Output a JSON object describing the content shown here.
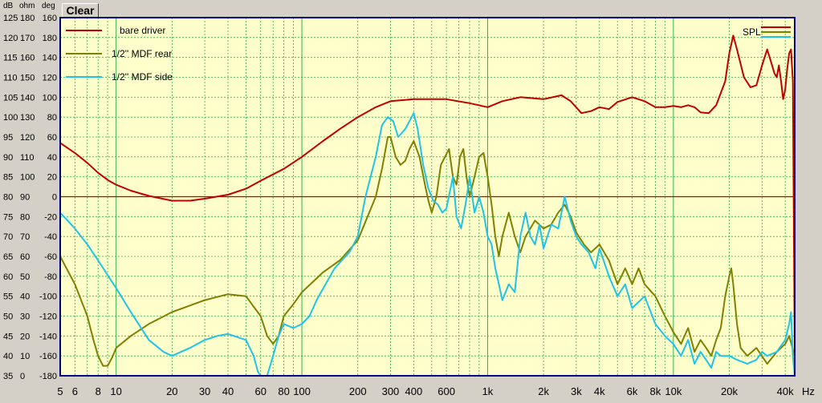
{
  "header": {
    "db_label": "dB",
    "ohm_label": "ohm",
    "deg_label": "deg",
    "clear_button": "Clear"
  },
  "colors": {
    "bare": "#c00000",
    "rear": "#808000",
    "side": "#1fc3e8",
    "grid": "#2db24a",
    "background": "#ffffcc",
    "frame": "#000080"
  },
  "chart_data": {
    "type": "line",
    "x_scale": "log",
    "xlim": [
      5,
      45000
    ],
    "x_ticks": [
      {
        "v": 5,
        "label": "5"
      },
      {
        "v": 6,
        "label": "6"
      },
      {
        "v": 8,
        "label": "8"
      },
      {
        "v": 10,
        "label": "10"
      },
      {
        "v": 20,
        "label": "20"
      },
      {
        "v": 30,
        "label": "30"
      },
      {
        "v": 40,
        "label": "40"
      },
      {
        "v": 60,
        "label": "60"
      },
      {
        "v": 80,
        "label": "80"
      },
      {
        "v": 100,
        "label": "100"
      },
      {
        "v": 200,
        "label": "200"
      },
      {
        "v": 300,
        "label": "300"
      },
      {
        "v": 400,
        "label": "400"
      },
      {
        "v": 600,
        "label": "600"
      },
      {
        "v": 1000,
        "label": "1k"
      },
      {
        "v": 2000,
        "label": "2k"
      },
      {
        "v": 3000,
        "label": "3k"
      },
      {
        "v": 4000,
        "label": "4k"
      },
      {
        "v": 6000,
        "label": "6k"
      },
      {
        "v": 8000,
        "label": "8k"
      },
      {
        "v": 10000,
        "label": "10k"
      },
      {
        "v": 20000,
        "label": "20k"
      },
      {
        "v": 40000,
        "label": "40k"
      }
    ],
    "x_unit": "Hz",
    "ylim": [
      35,
      125
    ],
    "y_ticks": [
      {
        "db": "125",
        "ohm": "180",
        "deg": "160"
      },
      {
        "db": "120",
        "ohm": "170",
        "deg": "180"
      },
      {
        "db": "115",
        "ohm": "160",
        "deg": "140"
      },
      {
        "db": "110",
        "ohm": "150",
        "deg": "120"
      },
      {
        "db": "105",
        "ohm": "140",
        "deg": "100"
      },
      {
        "db": "100",
        "ohm": "130",
        "deg": "80"
      },
      {
        "db": "95",
        "ohm": "120",
        "deg": "60"
      },
      {
        "db": "90",
        "ohm": "110",
        "deg": "40"
      },
      {
        "db": "85",
        "ohm": "100",
        "deg": "20"
      },
      {
        "db": "80",
        "ohm": "90",
        "deg": "0"
      },
      {
        "db": "75",
        "ohm": "80",
        "deg": "-20"
      },
      {
        "db": "70",
        "ohm": "70",
        "deg": "-40"
      },
      {
        "db": "65",
        "ohm": "60",
        "deg": "-60"
      },
      {
        "db": "60",
        "ohm": "50",
        "deg": "-80"
      },
      {
        "db": "55",
        "ohm": "40",
        "deg": "-100"
      },
      {
        "db": "50",
        "ohm": "30",
        "deg": "-120"
      },
      {
        "db": "45",
        "ohm": "20",
        "deg": "-140"
      },
      {
        "db": "40",
        "ohm": "10",
        "deg": "-160"
      },
      {
        "db": "35",
        "ohm": "0",
        "deg": "-180"
      }
    ],
    "reference_line_db": 80,
    "legend_right": "SPL",
    "series": [
      {
        "name": "bare driver",
        "color": "#c00000",
        "points": [
          [
            5,
            93.5
          ],
          [
            6,
            91
          ],
          [
            7,
            88.5
          ],
          [
            8,
            86
          ],
          [
            9,
            84.2
          ],
          [
            10,
            83
          ],
          [
            12,
            81.5
          ],
          [
            15,
            80.2
          ],
          [
            20,
            79
          ],
          [
            25,
            79
          ],
          [
            30,
            79.5
          ],
          [
            40,
            80.5
          ],
          [
            50,
            82
          ],
          [
            60,
            84
          ],
          [
            80,
            87
          ],
          [
            100,
            90
          ],
          [
            130,
            94
          ],
          [
            160,
            97
          ],
          [
            200,
            100
          ],
          [
            250,
            102.5
          ],
          [
            300,
            104
          ],
          [
            400,
            104.5
          ],
          [
            600,
            104.5
          ],
          [
            800,
            103.5
          ],
          [
            1000,
            102.5
          ],
          [
            1200,
            104
          ],
          [
            1500,
            105
          ],
          [
            2000,
            104.5
          ],
          [
            2500,
            105.5
          ],
          [
            2800,
            104
          ],
          [
            3200,
            101
          ],
          [
            3600,
            101.5
          ],
          [
            4000,
            102.5
          ],
          [
            4500,
            102
          ],
          [
            5000,
            103.8
          ],
          [
            6000,
            105
          ],
          [
            7000,
            104
          ],
          [
            8000,
            102.5
          ],
          [
            9000,
            102.5
          ],
          [
            10000,
            102.8
          ],
          [
            11000,
            102.5
          ],
          [
            12000,
            103
          ],
          [
            13000,
            102.5
          ],
          [
            14000,
            101.2
          ],
          [
            15500,
            101
          ],
          [
            17000,
            103
          ],
          [
            19000,
            109
          ],
          [
            20000,
            116
          ],
          [
            21000,
            120.5
          ],
          [
            22000,
            117
          ],
          [
            24000,
            110
          ],
          [
            26000,
            107.5
          ],
          [
            28000,
            108
          ],
          [
            30000,
            113
          ],
          [
            32000,
            117
          ],
          [
            33000,
            115
          ],
          [
            34000,
            113
          ],
          [
            35000,
            111
          ],
          [
            36000,
            110
          ],
          [
            37000,
            113
          ],
          [
            38000,
            109
          ],
          [
            39000,
            104.5
          ],
          [
            40000,
            107
          ],
          [
            41000,
            112
          ],
          [
            42000,
            116
          ],
          [
            43000,
            117
          ],
          [
            44000,
            109
          ],
          [
            45000,
            40
          ]
        ]
      },
      {
        "name": "1/2'' MDF rear",
        "color": "#808000",
        "points": [
          [
            5,
            65
          ],
          [
            6,
            58
          ],
          [
            7,
            50
          ],
          [
            7.5,
            44.5
          ],
          [
            8,
            40
          ],
          [
            8.5,
            37.5
          ],
          [
            9,
            37.5
          ],
          [
            9.5,
            39.5
          ],
          [
            10,
            42
          ],
          [
            12,
            45
          ],
          [
            15,
            48
          ],
          [
            20,
            51
          ],
          [
            30,
            54
          ],
          [
            40,
            55.5
          ],
          [
            50,
            55
          ],
          [
            60,
            50
          ],
          [
            65,
            45
          ],
          [
            70,
            43
          ],
          [
            75,
            45
          ],
          [
            80,
            50
          ],
          [
            90,
            53
          ],
          [
            100,
            56
          ],
          [
            130,
            61
          ],
          [
            160,
            64
          ],
          [
            200,
            69
          ],
          [
            250,
            80
          ],
          [
            270,
            87
          ],
          [
            290,
            95
          ],
          [
            300,
            95
          ],
          [
            320,
            90
          ],
          [
            340,
            88
          ],
          [
            360,
            89
          ],
          [
            380,
            92
          ],
          [
            400,
            94
          ],
          [
            430,
            90
          ],
          [
            460,
            83
          ],
          [
            480,
            79
          ],
          [
            500,
            76
          ],
          [
            530,
            80
          ],
          [
            560,
            88
          ],
          [
            590,
            90
          ],
          [
            620,
            92
          ],
          [
            650,
            85
          ],
          [
            680,
            83
          ],
          [
            710,
            90
          ],
          [
            740,
            92
          ],
          [
            770,
            85
          ],
          [
            800,
            80
          ],
          [
            850,
            85
          ],
          [
            900,
            90
          ],
          [
            950,
            91
          ],
          [
            1000,
            85
          ],
          [
            1050,
            78
          ],
          [
            1100,
            70
          ],
          [
            1150,
            65
          ],
          [
            1200,
            70
          ],
          [
            1300,
            76
          ],
          [
            1400,
            70
          ],
          [
            1500,
            66
          ],
          [
            1600,
            70
          ],
          [
            1800,
            74
          ],
          [
            2000,
            72
          ],
          [
            2200,
            73
          ],
          [
            2400,
            76
          ],
          [
            2600,
            78
          ],
          [
            2800,
            75
          ],
          [
            3000,
            71
          ],
          [
            3300,
            68
          ],
          [
            3600,
            66
          ],
          [
            4000,
            68
          ],
          [
            4500,
            64
          ],
          [
            5000,
            58
          ],
          [
            5500,
            62
          ],
          [
            6000,
            58
          ],
          [
            6500,
            62
          ],
          [
            7000,
            58
          ],
          [
            8000,
            55
          ],
          [
            9000,
            50
          ],
          [
            10000,
            46
          ],
          [
            11000,
            43
          ],
          [
            12000,
            47
          ],
          [
            13000,
            41
          ],
          [
            14000,
            44
          ],
          [
            15000,
            42
          ],
          [
            16000,
            40
          ],
          [
            17000,
            44
          ],
          [
            18000,
            47
          ],
          [
            19000,
            55
          ],
          [
            20000,
            60
          ],
          [
            20500,
            62
          ],
          [
            21000,
            58
          ],
          [
            22000,
            48
          ],
          [
            23000,
            42
          ],
          [
            25000,
            40
          ],
          [
            28000,
            42
          ],
          [
            32000,
            38
          ],
          [
            36000,
            41
          ],
          [
            40000,
            43
          ],
          [
            42000,
            45
          ],
          [
            45000,
            40
          ]
        ]
      },
      {
        "name": "1/2'' MDF side",
        "color": "#1fc3e8",
        "points": [
          [
            5,
            76
          ],
          [
            6,
            72
          ],
          [
            7,
            68
          ],
          [
            8,
            64
          ],
          [
            10,
            57
          ],
          [
            12,
            51
          ],
          [
            15,
            44
          ],
          [
            18,
            41
          ],
          [
            20,
            40
          ],
          [
            25,
            42
          ],
          [
            30,
            44
          ],
          [
            35,
            45
          ],
          [
            40,
            45.5
          ],
          [
            50,
            44
          ],
          [
            55,
            40
          ],
          [
            58,
            36
          ],
          [
            60,
            34
          ],
          [
            65,
            35
          ],
          [
            70,
            40
          ],
          [
            75,
            45
          ],
          [
            80,
            48
          ],
          [
            90,
            47
          ],
          [
            100,
            48
          ],
          [
            110,
            50
          ],
          [
            120,
            54
          ],
          [
            150,
            62
          ],
          [
            180,
            66
          ],
          [
            200,
            70
          ],
          [
            220,
            80
          ],
          [
            250,
            90
          ],
          [
            270,
            98
          ],
          [
            290,
            100
          ],
          [
            310,
            99
          ],
          [
            330,
            95
          ],
          [
            360,
            97
          ],
          [
            380,
            99
          ],
          [
            400,
            101
          ],
          [
            420,
            97
          ],
          [
            450,
            88
          ],
          [
            480,
            82
          ],
          [
            510,
            79
          ],
          [
            540,
            78
          ],
          [
            570,
            76
          ],
          [
            600,
            77
          ],
          [
            650,
            85
          ],
          [
            680,
            75
          ],
          [
            720,
            72
          ],
          [
            760,
            78
          ],
          [
            800,
            85
          ],
          [
            850,
            76
          ],
          [
            900,
            80
          ],
          [
            950,
            76
          ],
          [
            1000,
            70
          ],
          [
            1050,
            68
          ],
          [
            1100,
            62
          ],
          [
            1150,
            58
          ],
          [
            1200,
            54
          ],
          [
            1300,
            58
          ],
          [
            1400,
            56
          ],
          [
            1500,
            70
          ],
          [
            1600,
            76
          ],
          [
            1700,
            70
          ],
          [
            1800,
            68
          ],
          [
            1900,
            73
          ],
          [
            2000,
            67
          ],
          [
            2200,
            73
          ],
          [
            2400,
            72
          ],
          [
            2600,
            80
          ],
          [
            2800,
            74
          ],
          [
            3000,
            70
          ],
          [
            3200,
            68
          ],
          [
            3500,
            66
          ],
          [
            3800,
            62
          ],
          [
            4000,
            67
          ],
          [
            4500,
            60
          ],
          [
            5000,
            55
          ],
          [
            5500,
            58
          ],
          [
            6000,
            52
          ],
          [
            7000,
            55
          ],
          [
            8000,
            48
          ],
          [
            9000,
            45
          ],
          [
            10000,
            43
          ],
          [
            11000,
            40
          ],
          [
            12000,
            44
          ],
          [
            13000,
            38
          ],
          [
            14000,
            41
          ],
          [
            15000,
            39
          ],
          [
            16000,
            37
          ],
          [
            17000,
            41
          ],
          [
            18000,
            40
          ],
          [
            20000,
            40
          ],
          [
            22000,
            39
          ],
          [
            25000,
            38
          ],
          [
            28000,
            39
          ],
          [
            30000,
            41
          ],
          [
            32000,
            40
          ],
          [
            36000,
            41
          ],
          [
            40000,
            44
          ],
          [
            42000,
            48
          ],
          [
            43000,
            51
          ],
          [
            44000,
            40
          ],
          [
            45000,
            35
          ]
        ]
      }
    ]
  }
}
